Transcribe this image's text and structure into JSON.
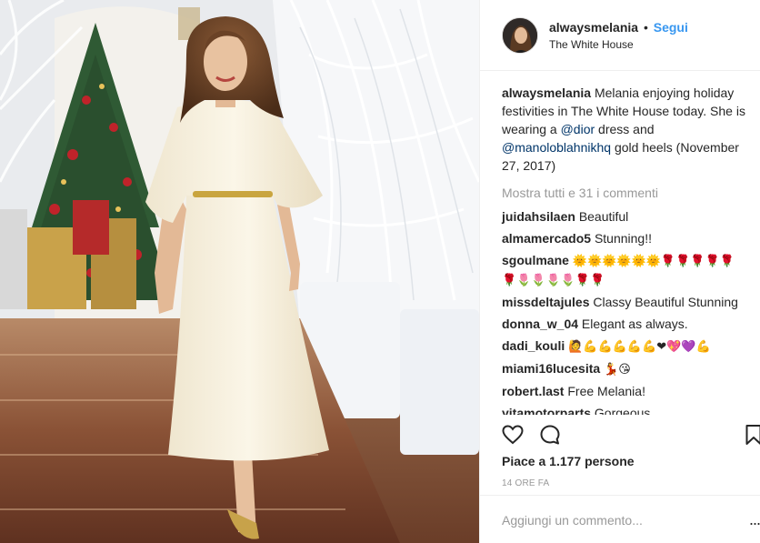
{
  "post": {
    "header": {
      "username": "alwaysmelania",
      "separator": "•",
      "follow_label": "Segui",
      "location": "The White House"
    },
    "caption": {
      "username": "alwaysmelania",
      "text_1": " Melania enjoying holiday festivities in The White House today. She is wearing a ",
      "mention_1": "@dior",
      "text_2": " dress and ",
      "mention_2": "@manoloblahnikhq",
      "text_3": " gold heels (November 27, 2017)"
    },
    "load_more_label": "Mostra tutti e 31 i commenti",
    "comments": [
      {
        "user": "juidahsilaen",
        "text": "Beautiful"
      },
      {
        "user": "almamercado5",
        "text": "Stunning!!"
      },
      {
        "user": "sgoulmane",
        "text": "🌞🌞🌞🌞🌞🌞🌹🌹🌹🌹🌹🌹🌷🌷🌷🌷🌹🌹"
      },
      {
        "user": "missdeltajules",
        "text": "Classy Beautiful Stunning"
      },
      {
        "user": "donna_w_04",
        "text": "Elegant as always."
      },
      {
        "user": "dadi_kouli",
        "text": "🙋💪💪💪💪💪❤💖💜💪"
      },
      {
        "user": "miami16lucesita",
        "text": "💃😘"
      },
      {
        "user": "robert.last",
        "text": "Free Melania!"
      },
      {
        "user": "yitamotorparts",
        "text": "Gorgeous"
      }
    ],
    "actions": {
      "like_icon": "heart-icon",
      "comment_icon": "speech-bubble-icon",
      "save_icon": "bookmark-icon"
    },
    "likes_text": "Piace a 1.177 persone",
    "timestamp": "14 ORE FA",
    "add_comment": {
      "placeholder": "Aggiungi un commento...",
      "more_icon": "more-dots-icon",
      "more_label": "..."
    },
    "colors": {
      "link_blue": "#3897f0",
      "mention": "#003569",
      "muted": "#999999",
      "text": "#262626",
      "divider": "#efefef"
    }
  }
}
